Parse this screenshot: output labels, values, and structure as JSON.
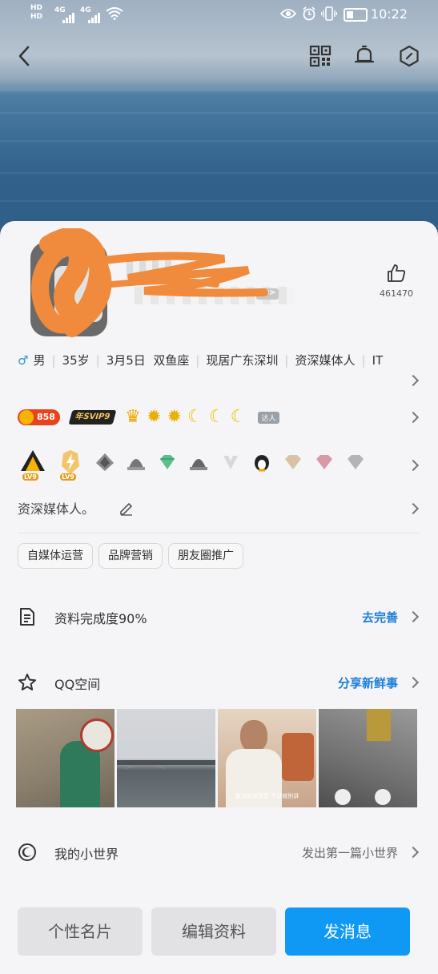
{
  "status_bar": {
    "hd_top": "HD",
    "hd_bottom": "HD",
    "net1": "4G",
    "net2": "4G",
    "time": "10:22"
  },
  "nav": {
    "back_icon": "back-arrow-icon",
    "qr_icon": "qr-code-icon",
    "bell_icon": "bell-icon",
    "settings_icon": "hexagon-settings-icon"
  },
  "profile": {
    "id_tag": "ID>",
    "likes": "461470",
    "gender": "男",
    "age": "35岁",
    "birthday": "3月5日",
    "zodiac": "双鱼座",
    "location": "现居广东深圳",
    "occupation": "资深媒体人",
    "industry": "IT",
    "bio": "资深媒体人。",
    "tags": [
      "自媒体运营",
      "品牌营销",
      "朋友圈推广"
    ]
  },
  "badges": {
    "coin_value": "858",
    "svip_label": "年SVIP9",
    "daren_label": "达人",
    "lv_a": "LV9",
    "lv_b": "LV9"
  },
  "rows": {
    "completeness": {
      "label": "资料完成度90%",
      "action": "去完善"
    },
    "qzone": {
      "label": "QQ空间",
      "action": "分享新鲜事"
    },
    "world": {
      "label": "我的小世界",
      "action": "发出第一篇小世界"
    }
  },
  "photos": {
    "p3_caption": "要讲就讲清楚 不讲就别讲"
  },
  "buttons": {
    "card": "个性名片",
    "edit": "编辑资料",
    "message": "发消息"
  },
  "colors": {
    "accent_blue": "#0f99f5",
    "link_blue": "#1b7ed8",
    "scribble_orange": "#f08a3c"
  }
}
